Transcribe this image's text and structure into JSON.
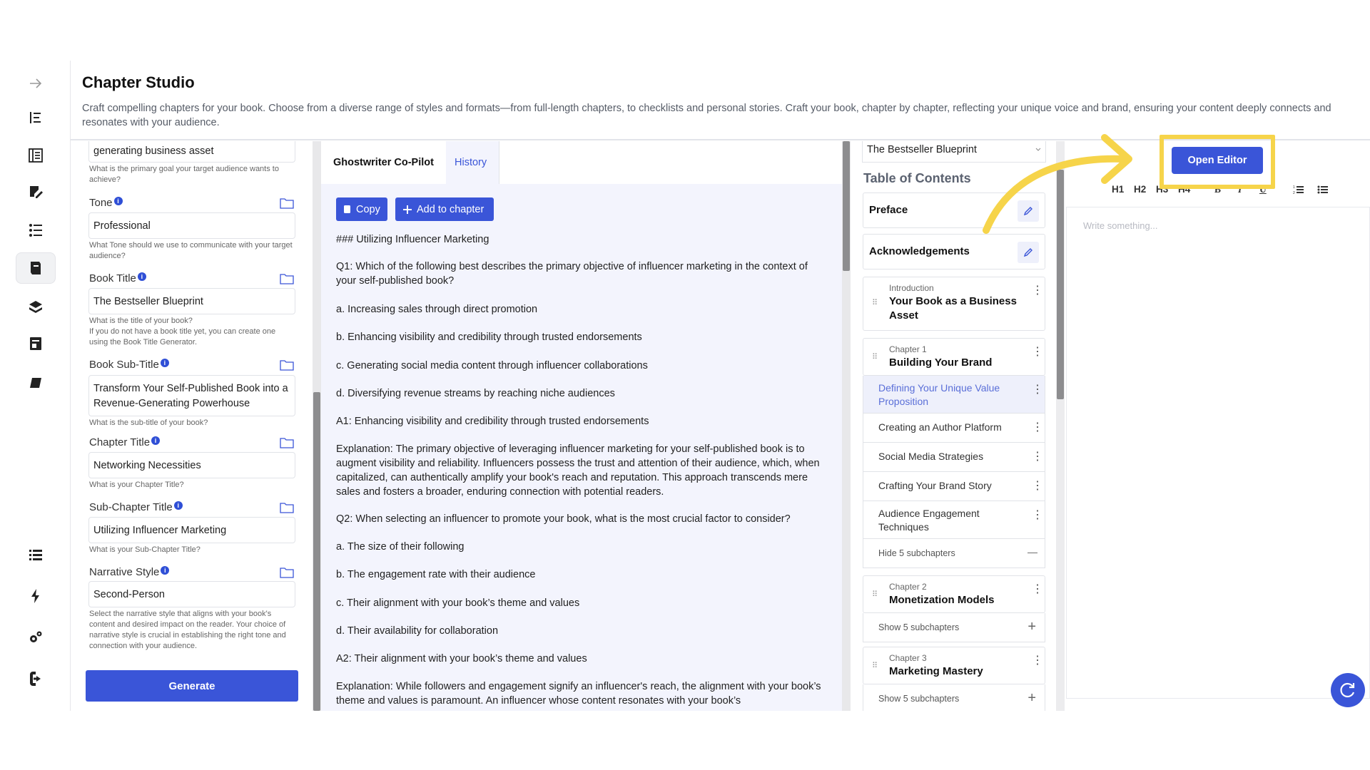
{
  "header": {
    "title": "Chapter Studio",
    "description": "Craft compelling chapters for your book. Choose from a diverse range of styles and formats—from full-length chapters, to checklists and personal stories. Craft your book, chapter by chapter, reflecting your unique voice and brand, ensuring your content deeply connects and resonates with your audience."
  },
  "form": {
    "goal_value": "generating business asset",
    "goal_help": "What is the primary goal your target audience wants to achieve?",
    "tone_label": "Tone",
    "tone_value": "Professional",
    "tone_help": "What Tone should we use to communicate with your target audience?",
    "book_title_label": "Book Title",
    "book_title_value": "The Bestseller Blueprint",
    "book_title_help": "What is the title of your book?\nIf you do not have a book title yet, you can create one using the Book Title Generator.",
    "book_subtitle_label": "Book Sub-Title",
    "book_subtitle_value": "Transform Your Self-Published Book into a Revenue-Generating Powerhouse",
    "book_subtitle_help": "What is the sub-title of your book?",
    "chapter_title_label": "Chapter Title",
    "chapter_title_value": "Networking Necessities",
    "chapter_title_help": "What is your Chapter Title?",
    "subchapter_title_label": "Sub-Chapter Title",
    "subchapter_title_value": "Utilizing Influencer Marketing",
    "subchapter_title_help": "What is your Sub-Chapter Title?",
    "narrative_label": "Narrative Style",
    "narrative_value": "Second-Person",
    "narrative_help": "Select the narrative style that aligns with your book's content and desired impact on the reader. Your choice of narrative style is crucial in establishing the right tone and connection with your audience.",
    "generate_label": "Generate",
    "info_glyph": "i"
  },
  "copilot": {
    "tab_active": "Ghostwriter Co-Pilot",
    "tab_history": "History",
    "copy_label": "Copy",
    "add_label": "Add to chapter",
    "paragraphs": [
      "### Utilizing Influencer Marketing",
      "Q1: Which of the following best describes the primary objective of influencer marketing in the context of your self-published book?",
      "a. Increasing sales through direct promotion",
      "b. Enhancing visibility and credibility through trusted endorsements",
      "c. Generating social media content through influencer collaborations",
      "d. Diversifying revenue streams by reaching niche audiences",
      "A1: Enhancing visibility and credibility through trusted endorsements",
      "Explanation: The primary objective of leveraging influencer marketing for your self-published book is to augment visibility and reliability. Influencers possess the trust and attention of their audience, which, when capitalized, can authentically amplify your book's reach and reputation. This approach transcends mere sales and fosters a broader, enduring connection with potential readers.",
      "Q2: When selecting an influencer to promote your book, what is the most crucial factor to consider?",
      "a. The size of their following",
      "b. The engagement rate with their audience",
      "c. Their alignment with your book’s theme and values",
      "d. Their availability for collaboration",
      "A2: Their alignment with your book’s theme and values",
      "Explanation: While followers and engagement signify an influencer's reach, the alignment with your book’s theme and values is paramount. An influencer whose content resonates with your book’s"
    ]
  },
  "toc": {
    "book_select": "The Bestseller Blueprint",
    "heading": "Table of Contents",
    "preface": "Preface",
    "acknowledgements": "Acknowledgements",
    "intro_small": "Introduction",
    "intro_title": "Your Book as a Business Asset",
    "ch1_small": "Chapter 1",
    "ch1_title": "Building Your Brand",
    "ch1_subs": [
      "Defining Your Unique Value Proposition",
      "Creating an Author Platform",
      "Social Media Strategies",
      "Crafting Your Brand Story",
      "Audience Engagement Techniques"
    ],
    "ch1_toggle": "Hide 5 subchapters",
    "ch2_small": "Chapter 2",
    "ch2_title": "Monetization Models",
    "ch2_toggle": "Show 5 subchapters",
    "ch3_small": "Chapter 3",
    "ch3_title": "Marketing Mastery",
    "ch3_toggle": "Show 5 subchapters",
    "kebab": "⋮",
    "drag": "⠿",
    "minus": "—",
    "plus": "+"
  },
  "editor": {
    "open_label": "Open Editor",
    "tools": [
      "H1",
      "H2",
      "H3",
      "H4",
      "B",
      "I",
      "U"
    ],
    "placeholder": "Write something..."
  },
  "colors": {
    "accent": "#3a55d8",
    "highlight": "#f6d44a",
    "active_sub_bg": "#eef0fb",
    "active_sub_text": "#5a6fd8"
  }
}
